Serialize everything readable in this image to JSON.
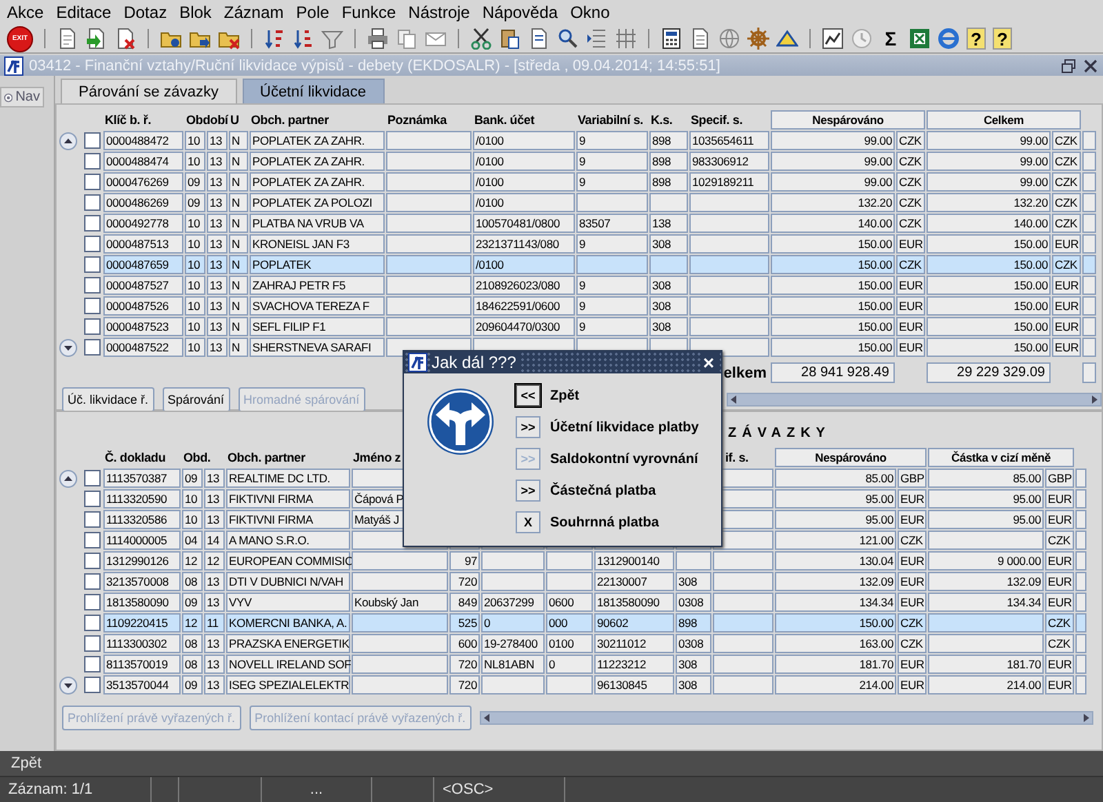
{
  "menu": [
    "Akce",
    "Editace",
    "Dotaz",
    "Blok",
    "Záznam",
    "Pole",
    "Funkce",
    "Nástroje",
    "Nápověda",
    "Okno"
  ],
  "toolbar": {
    "exit_label": "EXIT",
    "sum_symbol": "Σ",
    "help_symbols": [
      "?",
      "?"
    ]
  },
  "window": {
    "title": "03412 - Finanční vztahy/Ruční likvidace výpisů - debety (EKDOSALR) - [středa , 09.04.2014; 14:55:51]"
  },
  "nav": {
    "label": "Nav"
  },
  "tabs": [
    {
      "label": "Párování se závazky",
      "selected": true
    },
    {
      "label": "Účetní likvidace",
      "selected": false
    }
  ],
  "top_table": {
    "columns": [
      "Klíč b. ř.",
      "Období",
      "U",
      "Obch. partner",
      "Poznámka",
      "Bank. účet",
      "Variabilní s.",
      "K.s.",
      "Specif. s.",
      "Nespárováno",
      "Celkem"
    ],
    "rows": [
      {
        "key": "0000488472",
        "period": [
          "10",
          "13"
        ],
        "u": "N",
        "partner": "POPLATEK ZA ZAHR.",
        "bank": "/0100",
        "var": "9",
        "ks": "898",
        "spec": "1035654611",
        "unpaired": "99.00",
        "unpaired_cur": "CZK",
        "total": "99.00",
        "total_cur": "CZK",
        "checked": false,
        "selected": false
      },
      {
        "key": "0000488474",
        "period": [
          "10",
          "13"
        ],
        "u": "N",
        "partner": "POPLATEK ZA ZAHR.",
        "bank": "/0100",
        "var": "9",
        "ks": "898",
        "spec": "983306912",
        "unpaired": "99.00",
        "unpaired_cur": "CZK",
        "total": "99.00",
        "total_cur": "CZK",
        "checked": false,
        "selected": false
      },
      {
        "key": "0000476269",
        "period": [
          "09",
          "13"
        ],
        "u": "N",
        "partner": "POPLATEK ZA ZAHR.",
        "bank": "/0100",
        "var": "9",
        "ks": "898",
        "spec": "1029189211",
        "unpaired": "99.00",
        "unpaired_cur": "CZK",
        "total": "99.00",
        "total_cur": "CZK",
        "checked": false,
        "selected": false
      },
      {
        "key": "0000486269",
        "period": [
          "09",
          "13"
        ],
        "u": "N",
        "partner": "POPLATEK ZA POLOZI",
        "bank": "/0100",
        "unpaired": "132.20",
        "unpaired_cur": "CZK",
        "total": "132.20",
        "total_cur": "CZK",
        "checked": false,
        "selected": false
      },
      {
        "key": "0000492778",
        "period": [
          "10",
          "13"
        ],
        "u": "N",
        "partner": "PLATBA NA VRUB VA",
        "bank": "100570481/0800",
        "var": "83507",
        "ks": "138",
        "unpaired": "140.00",
        "unpaired_cur": "CZK",
        "total": "140.00",
        "total_cur": "CZK",
        "checked": false,
        "selected": false
      },
      {
        "key": "0000487513",
        "period": [
          "10",
          "13"
        ],
        "u": "N",
        "partner": "KRONEISL JAN F3",
        "bank": "2321371143/080",
        "var": "9",
        "ks": "308",
        "unpaired": "150.00",
        "unpaired_cur": "EUR",
        "total": "150.00",
        "total_cur": "EUR",
        "checked": false,
        "selected": false
      },
      {
        "key": "0000487659",
        "period": [
          "10",
          "13"
        ],
        "u": "N",
        "partner": "POPLATEK",
        "bank": "/0100",
        "unpaired": "150.00",
        "unpaired_cur": "CZK",
        "total": "150.00",
        "total_cur": "CZK",
        "checked": false,
        "selected": true
      },
      {
        "key": "0000487527",
        "period": [
          "10",
          "13"
        ],
        "u": "N",
        "partner": "ZAHRAJ PETR F5",
        "bank": "2108926023/080",
        "var": "9",
        "ks": "308",
        "unpaired": "150.00",
        "unpaired_cur": "EUR",
        "total": "150.00",
        "total_cur": "EUR",
        "checked": false,
        "selected": false
      },
      {
        "key": "0000487526",
        "period": [
          "10",
          "13"
        ],
        "u": "N",
        "partner": "SVACHOVA TEREZA F",
        "bank": "184622591/0600",
        "var": "9",
        "ks": "308",
        "unpaired": "150.00",
        "unpaired_cur": "EUR",
        "total": "150.00",
        "total_cur": "EUR",
        "checked": false,
        "selected": false
      },
      {
        "key": "0000487523",
        "period": [
          "10",
          "13"
        ],
        "u": "N",
        "partner": "SEFL FILIP F1",
        "bank": "209604470/0300",
        "var": "9",
        "ks": "308",
        "unpaired": "150.00",
        "unpaired_cur": "EUR",
        "total": "150.00",
        "total_cur": "EUR",
        "checked": false,
        "selected": false
      },
      {
        "key": "0000487522",
        "period": [
          "10",
          "13"
        ],
        "u": "N",
        "partner": "SHERSTNEVA SARAFI",
        "unpaired": "150.00",
        "unpaired_cur": "EUR",
        "total": "150.00",
        "total_cur": "EUR",
        "checked": false,
        "selected": false
      }
    ],
    "totals": {
      "label": "elkem",
      "unpaired": "28 941 928.49",
      "total": "29 229 329.09"
    },
    "buttons": [
      {
        "label": "Úč. likvidace ř.",
        "disabled": false
      },
      {
        "label": "Spárování",
        "disabled": false
      },
      {
        "label": "Hromadné spárování",
        "disabled": true
      }
    ]
  },
  "bottom_table": {
    "section_title": "ZÁVAZKY",
    "columns": [
      "Č. dokladu",
      "Obd.",
      "Obch. partner",
      "Jméno z",
      "if. s.",
      "Nespárováno",
      "Částka v cizí měně"
    ],
    "rows": [
      {
        "doc": "1113570387",
        "period": [
          "09",
          "13"
        ],
        "partner": "REALTIME DC LTD.",
        "unpaired": "85.00",
        "unpaired_cur": "GBP",
        "foreign": "85.00",
        "foreign_cur": "GBP",
        "checked": false,
        "selected": false
      },
      {
        "doc": "1113320590",
        "period": [
          "10",
          "13"
        ],
        "partner": "FIKTIVNI FIRMA",
        "name": "Čápová P",
        "unpaired": "95.00",
        "unpaired_cur": "EUR",
        "foreign": "95.00",
        "foreign_cur": "EUR",
        "checked": false,
        "selected": false
      },
      {
        "doc": "1113320586",
        "period": [
          "10",
          "13"
        ],
        "partner": "FIKTIVNI FIRMA",
        "name": "Matyáš J",
        "unpaired": "95.00",
        "unpaired_cur": "EUR",
        "foreign": "95.00",
        "foreign_cur": "EUR",
        "checked": false,
        "selected": false
      },
      {
        "doc": "1114000005",
        "period": [
          "04",
          "14"
        ],
        "partner": "A MANO  S.R.O.",
        "unpaired": "121.00",
        "unpaired_cur": "CZK",
        "foreign_cur": "CZK",
        "checked": false,
        "selected": false
      },
      {
        "doc": "1312990126",
        "period": [
          "12",
          "12"
        ],
        "partner": "EUROPEAN COMMISIO",
        "column_6": "97",
        "var": "1312900140",
        "unpaired": "130.04",
        "unpaired_cur": "EUR",
        "foreign": "9 000.00",
        "foreign_cur": "EUR",
        "checked": false,
        "selected": false
      },
      {
        "doc": "3213570008",
        "period": [
          "08",
          "13"
        ],
        "partner": "DTI V DUBNICI N/VAH",
        "column_6": "720",
        "var": "22130007",
        "ks": "308",
        "unpaired": "132.09",
        "unpaired_cur": "EUR",
        "foreign": "132.09",
        "foreign_cur": "EUR",
        "checked": false,
        "selected": false
      },
      {
        "doc": "1813580090",
        "period": [
          "09",
          "13"
        ],
        "partner": "VYV",
        "name": "Koubský Jan",
        "column_6": "849",
        "column_7": "20637299",
        "column_8": "0600",
        "var": "1813580090",
        "ks": "0308",
        "unpaired": "134.34",
        "unpaired_cur": "EUR",
        "foreign": "134.34",
        "foreign_cur": "EUR",
        "checked": false,
        "selected": false
      },
      {
        "doc": "1109220415",
        "period": [
          "12",
          "11"
        ],
        "partner": "KOMERCNI BANKA, A.",
        "column_6": "525",
        "column_7": "0",
        "column_8": "000",
        "var": "90602",
        "ks": "898",
        "unpaired": "150.00",
        "unpaired_cur": "CZK",
        "foreign_cur": "CZK",
        "checked": false,
        "selected": true
      },
      {
        "doc": "1113300302",
        "period": [
          "08",
          "13"
        ],
        "partner": "PRAZSKA ENERGETIK",
        "column_6": "600",
        "column_7": "19-278400",
        "column_8": "0100",
        "var": "30211012",
        "ks": "0308",
        "unpaired": "163.00",
        "unpaired_cur": "CZK",
        "foreign_cur": "CZK",
        "checked": false,
        "selected": false
      },
      {
        "doc": "8113570019",
        "period": [
          "08",
          "13"
        ],
        "partner": "NOVELL IRELAND SOF",
        "column_6": "720",
        "column_7": "NL81ABN",
        "column_8": "0",
        "var": "11223212",
        "ks": "308",
        "unpaired": "181.70",
        "unpaired_cur": "EUR",
        "foreign": "181.70",
        "foreign_cur": "EUR",
        "checked": false,
        "selected": false
      },
      {
        "doc": "3513570044",
        "period": [
          "09",
          "13"
        ],
        "partner": "ISEG SPEZIALELEKTR",
        "column_6": "720",
        "var": "96130845",
        "ks": "308",
        "unpaired": "214.00",
        "unpaired_cur": "EUR",
        "foreign": "214.00",
        "foreign_cur": "EUR",
        "checked": false,
        "selected": false
      }
    ],
    "buttons": [
      {
        "label": "Prohlížení právě vyřazených ř.",
        "disabled": true
      },
      {
        "label": "Prohlížení kontací právě vyřazených ř.",
        "disabled": true
      }
    ]
  },
  "dialog": {
    "title": "Jak dál ???",
    "close": "×",
    "options": [
      {
        "key": "<<",
        "label": "Zpět",
        "disabled": false,
        "focused": true
      },
      {
        "key": ">>",
        "label": "Účetní likvidace platby",
        "disabled": false,
        "focused": false
      },
      {
        "key": ">>",
        "label": "Saldokontní vyrovnání",
        "disabled": true,
        "focused": false
      },
      {
        "key": ">>",
        "label": "Částečná platba",
        "disabled": false,
        "focused": false
      },
      {
        "key": "X",
        "label": "Souhrnná platba",
        "disabled": false,
        "focused": false
      }
    ]
  },
  "status_bar": {
    "message": "Zpět",
    "record": "Záznam: 1/1",
    "ellipsis": "...",
    "mode": "<OSC>"
  }
}
